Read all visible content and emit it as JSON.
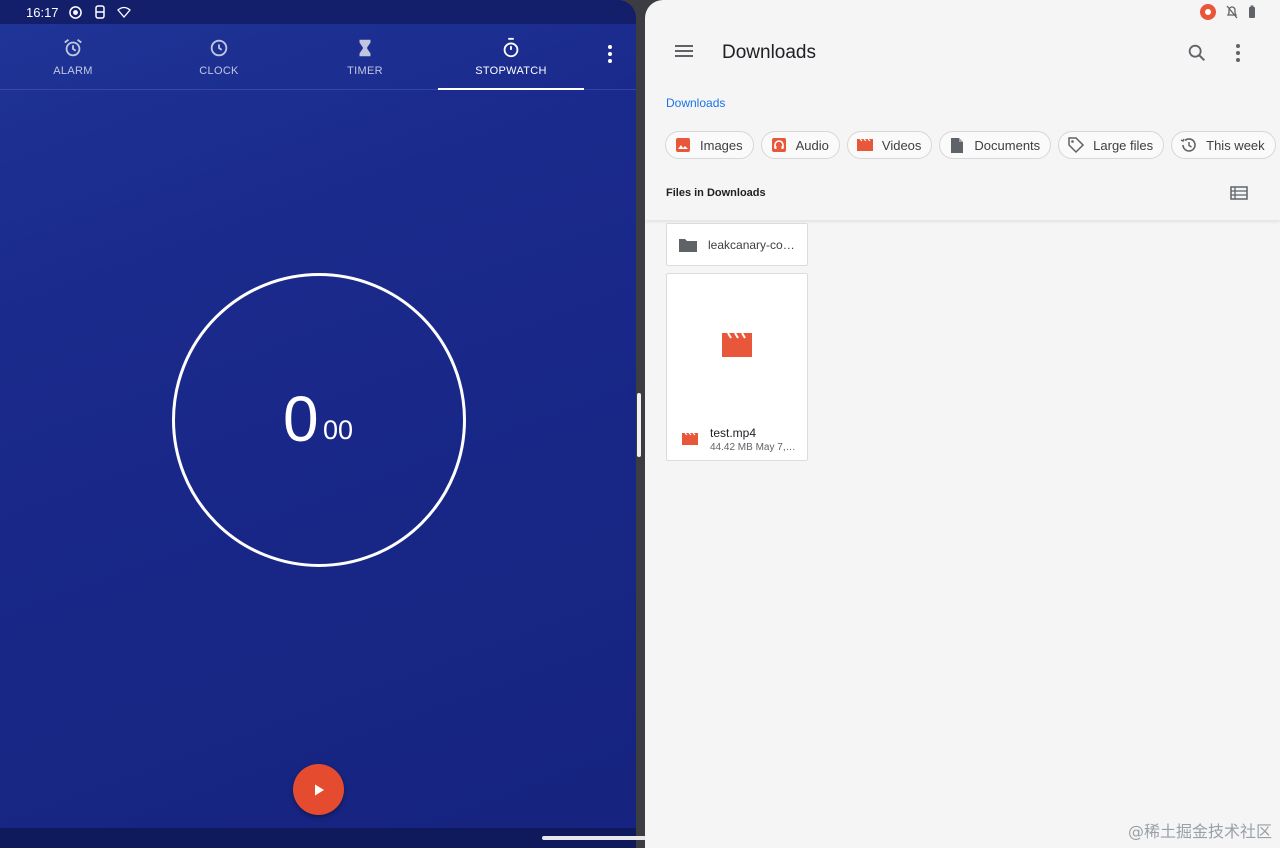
{
  "status_left": {
    "time": "16:17"
  },
  "clock_app": {
    "tabs": [
      {
        "label": "ALARM",
        "icon": "alarm-icon"
      },
      {
        "label": "CLOCK",
        "icon": "clock-icon"
      },
      {
        "label": "TIMER",
        "icon": "hourglass-icon"
      },
      {
        "label": "STOPWATCH",
        "icon": "stopwatch-icon",
        "active": true
      }
    ],
    "stopwatch": {
      "seconds": "0",
      "hundredths": "00"
    },
    "accent": "#e44b2f",
    "background": "#1a2a8c"
  },
  "files_app": {
    "title": "Downloads",
    "breadcrumb": "Downloads",
    "chips": [
      {
        "label": "Images",
        "icon": "image-icon"
      },
      {
        "label": "Audio",
        "icon": "headphones-icon"
      },
      {
        "label": "Videos",
        "icon": "movie-icon"
      },
      {
        "label": "Documents",
        "icon": "document-icon"
      },
      {
        "label": "Large files",
        "icon": "tag-icon"
      },
      {
        "label": "This week",
        "icon": "history-icon"
      }
    ],
    "section_label": "Files in Downloads",
    "folder": {
      "name": "leakcanary-co…",
      "icon": "folder-icon"
    },
    "file": {
      "name": "test.mp4",
      "meta": "44.42 MB May 7,…",
      "icon": "movie-icon"
    },
    "accent": "#e8573a",
    "link_color": "#1a73e8"
  },
  "watermark": "@稀土掘金技术社区"
}
